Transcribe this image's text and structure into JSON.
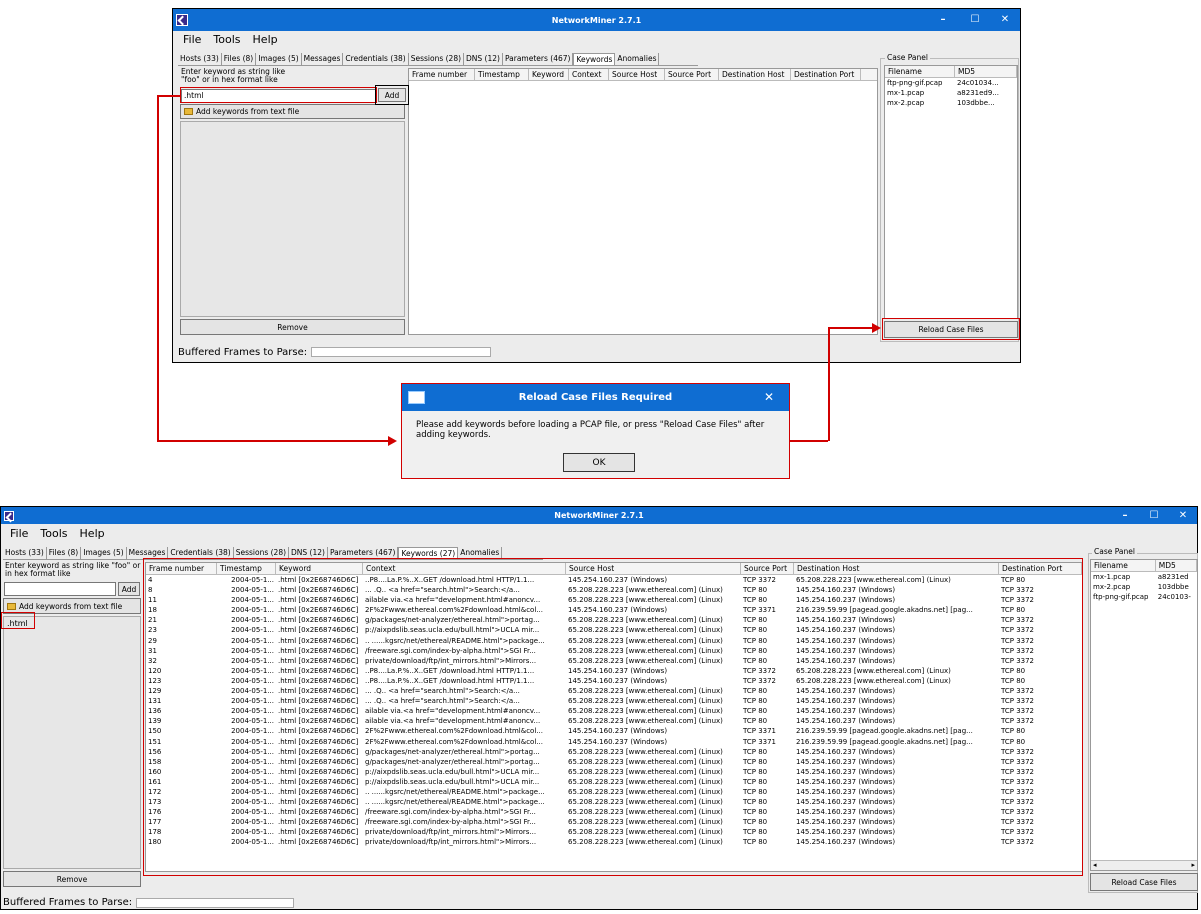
{
  "app": {
    "title": "NetworkMiner 2.7.1"
  },
  "menu": [
    "File",
    "Tools",
    "Help"
  ],
  "window_controls": [
    "–",
    "☐",
    "✕"
  ],
  "tabs_top": [
    {
      "label": "Hosts (33)"
    },
    {
      "label": "Files (8)"
    },
    {
      "label": "Images (5)"
    },
    {
      "label": "Messages"
    },
    {
      "label": "Credentials (38)"
    },
    {
      "label": "Sessions (28)"
    },
    {
      "label": "DNS (12)"
    },
    {
      "label": "Parameters (467)"
    },
    {
      "label": "Keywords"
    },
    {
      "label": "Anomalies"
    }
  ],
  "tabs_bottom": [
    {
      "label": "Hosts (33)"
    },
    {
      "label": "Files (8)"
    },
    {
      "label": "Images (5)"
    },
    {
      "label": "Messages"
    },
    {
      "label": "Credentials (38)"
    },
    {
      "label": "Sessions (28)"
    },
    {
      "label": "DNS (12)"
    },
    {
      "label": "Parameters (467)"
    },
    {
      "label": "Keywords (27)"
    },
    {
      "label": "Anomalies"
    }
  ],
  "keyword_panel": {
    "hint": "Enter keyword as string like \"foo\" or in hex format like",
    "input_value": ".html",
    "add_label": "Add",
    "add_from_file_label": "Add keywords from text file",
    "remove_label": "Remove",
    "list_items": [
      ".html"
    ]
  },
  "columns": [
    "Frame number",
    "Timestamp",
    "Keyword",
    "Context",
    "Source Host",
    "Source Port",
    "Destination Host",
    "Destination Port"
  ],
  "case_panel": {
    "legend": "Case Panel",
    "col_filename": "Filename",
    "col_md5": "MD5",
    "files_top": [
      {
        "name": "ftp-png-gif.pcap",
        "md5": "24c01034..."
      },
      {
        "name": "mx-1.pcap",
        "md5": "a8231ed9..."
      },
      {
        "name": "mx-2.pcap",
        "md5": "103dbbe..."
      }
    ],
    "files_bottom": [
      {
        "name": "mx-1.pcap",
        "md5": "a8231ed"
      },
      {
        "name": "mx-2.pcap",
        "md5": "103dbbe"
      },
      {
        "name": "ftp-png-gif.pcap",
        "md5": "24c0103-"
      }
    ],
    "reload_label": "Reload Case Files"
  },
  "status": {
    "buffered_label": "Buffered Frames to Parse:"
  },
  "dialog": {
    "title": "Reload Case Files Required",
    "message": "Please add keywords before loading a PCAP file, or press \"Reload Case Files\" after adding keywords.",
    "ok_label": "OK"
  },
  "rows": [
    [
      "4",
      "2004-05-1...",
      ".html [0x2E68746D6C]",
      "..P8....La.P.%..X..GET /download.html HTTP/1.1...",
      "145.254.160.237 (Windows)",
      "TCP 3372",
      "65.208.228.223 [www.ethereal.com] (Linux)",
      "TCP 80"
    ],
    [
      "8",
      "2004-05-1...",
      ".html [0x2E68746D6C]",
      "... .Q..          <a href=\"search.html\">Search:</a...",
      "65.208.228.223 [www.ethereal.com] (Linux)",
      "TCP 80",
      "145.254.160.237 (Windows)",
      "TCP 3372"
    ],
    [
      "11",
      "2004-05-1...",
      ".html [0x2E68746D6C]",
      "ailable via.<a href=\"development.html#anoncv...",
      "65.208.228.223 [www.ethereal.com] (Linux)",
      "TCP 80",
      "145.254.160.237 (Windows)",
      "TCP 3372"
    ],
    [
      "18",
      "2004-05-1...",
      ".html [0x2E68746D6C]",
      "2F%2Fwww.ethereal.com%2Fdownload.html&col...",
      "145.254.160.237 (Windows)",
      "TCP 3371",
      "216.239.59.99 [pagead.google.akadns.net] [pag...",
      "TCP 80"
    ],
    [
      "21",
      "2004-05-1...",
      ".html [0x2E68746D6C]",
      "g/packages/net-analyzer/ethereal.html\">portag...",
      "65.208.228.223 [www.ethereal.com] (Linux)",
      "TCP 80",
      "145.254.160.237 (Windows)",
      "TCP 3372"
    ],
    [
      "23",
      "2004-05-1...",
      ".html [0x2E68746D6C]",
      "p://aixpdslib.seas.ucla.edu/bull.html\">UCLA mir...",
      "65.208.228.223 [www.ethereal.com] (Linux)",
      "TCP 80",
      "145.254.160.237 (Windows)",
      "TCP 3372"
    ],
    [
      "29",
      "2004-05-1...",
      ".html [0x2E68746D6C]",
      ".. ......kgsrc/net/ethereal/README.html\">package...",
      "65.208.228.223 [www.ethereal.com] (Linux)",
      "TCP 80",
      "145.254.160.237 (Windows)",
      "TCP 3372"
    ],
    [
      "31",
      "2004-05-1...",
      ".html [0x2E68746D6C]",
      "/freeware.sgi.com/index-by-alpha.html\">SGI Fr...",
      "65.208.228.223 [www.ethereal.com] (Linux)",
      "TCP 80",
      "145.254.160.237 (Windows)",
      "TCP 3372"
    ],
    [
      "32",
      "2004-05-1...",
      ".html [0x2E68746D6C]",
      "private/download/ftp/int_mirrors.html\">Mirrors...",
      "65.208.228.223 [www.ethereal.com] (Linux)",
      "TCP 80",
      "145.254.160.237 (Windows)",
      "TCP 3372"
    ],
    [
      "120",
      "2004-05-1...",
      ".html [0x2E68746D6C]",
      "..P8....La.P.%..X..GET /download.html HTTP/1.1...",
      "145.254.160.237 (Windows)",
      "TCP 3372",
      "65.208.228.223 [www.ethereal.com] (Linux)",
      "TCP 80"
    ],
    [
      "123",
      "2004-05-1...",
      ".html [0x2E68746D6C]",
      "..P8....La.P.%..X..GET /download.html HTTP/1.1...",
      "145.254.160.237 (Windows)",
      "TCP 3372",
      "65.208.228.223 [www.ethereal.com] (Linux)",
      "TCP 80"
    ],
    [
      "129",
      "2004-05-1...",
      ".html [0x2E68746D6C]",
      "... .Q..          <a href=\"search.html\">Search:</a...",
      "65.208.228.223 [www.ethereal.com] (Linux)",
      "TCP 80",
      "145.254.160.237 (Windows)",
      "TCP 3372"
    ],
    [
      "131",
      "2004-05-1...",
      ".html [0x2E68746D6C]",
      "... .Q..          <a href=\"search.html\">Search:</a...",
      "65.208.228.223 [www.ethereal.com] (Linux)",
      "TCP 80",
      "145.254.160.237 (Windows)",
      "TCP 3372"
    ],
    [
      "136",
      "2004-05-1...",
      ".html [0x2E68746D6C]",
      "ailable via.<a href=\"development.html#anoncv...",
      "65.208.228.223 [www.ethereal.com] (Linux)",
      "TCP 80",
      "145.254.160.237 (Windows)",
      "TCP 3372"
    ],
    [
      "139",
      "2004-05-1...",
      ".html [0x2E68746D6C]",
      "ailable via.<a href=\"development.html#anoncv...",
      "65.208.228.223 [www.ethereal.com] (Linux)",
      "TCP 80",
      "145.254.160.237 (Windows)",
      "TCP 3372"
    ],
    [
      "150",
      "2004-05-1...",
      ".html [0x2E68746D6C]",
      "2F%2Fwww.ethereal.com%2Fdownload.html&col...",
      "145.254.160.237 (Windows)",
      "TCP 3371",
      "216.239.59.99 [pagead.google.akadns.net] [pag...",
      "TCP 80"
    ],
    [
      "151",
      "2004-05-1...",
      ".html [0x2E68746D6C]",
      "2F%2Fwww.ethereal.com%2Fdownload.html&col...",
      "145.254.160.237 (Windows)",
      "TCP 3371",
      "216.239.59.99 [pagead.google.akadns.net] [pag...",
      "TCP 80"
    ],
    [
      "156",
      "2004-05-1...",
      ".html [0x2E68746D6C]",
      "g/packages/net-analyzer/ethereal.html\">portag...",
      "65.208.228.223 [www.ethereal.com] (Linux)",
      "TCP 80",
      "145.254.160.237 (Windows)",
      "TCP 3372"
    ],
    [
      "158",
      "2004-05-1...",
      ".html [0x2E68746D6C]",
      "g/packages/net-analyzer/ethereal.html\">portag...",
      "65.208.228.223 [www.ethereal.com] (Linux)",
      "TCP 80",
      "145.254.160.237 (Windows)",
      "TCP 3372"
    ],
    [
      "160",
      "2004-05-1...",
      ".html [0x2E68746D6C]",
      "p://aixpdslib.seas.ucla.edu/bull.html\">UCLA mir...",
      "65.208.228.223 [www.ethereal.com] (Linux)",
      "TCP 80",
      "145.254.160.237 (Windows)",
      "TCP 3372"
    ],
    [
      "161",
      "2004-05-1...",
      ".html [0x2E68746D6C]",
      "p://aixpdslib.seas.ucla.edu/bull.html\">UCLA mir...",
      "65.208.228.223 [www.ethereal.com] (Linux)",
      "TCP 80",
      "145.254.160.237 (Windows)",
      "TCP 3372"
    ],
    [
      "172",
      "2004-05-1...",
      ".html [0x2E68746D6C]",
      ".. ......kgsrc/net/ethereal/README.html\">package...",
      "65.208.228.223 [www.ethereal.com] (Linux)",
      "TCP 80",
      "145.254.160.237 (Windows)",
      "TCP 3372"
    ],
    [
      "173",
      "2004-05-1...",
      ".html [0x2E68746D6C]",
      ".. ......kgsrc/net/ethereal/README.html\">package...",
      "65.208.228.223 [www.ethereal.com] (Linux)",
      "TCP 80",
      "145.254.160.237 (Windows)",
      "TCP 3372"
    ],
    [
      "176",
      "2004-05-1...",
      ".html [0x2E68746D6C]",
      "/freeware.sgi.com/index-by-alpha.html\">SGI Fr...",
      "65.208.228.223 [www.ethereal.com] (Linux)",
      "TCP 80",
      "145.254.160.237 (Windows)",
      "TCP 3372"
    ],
    [
      "177",
      "2004-05-1...",
      ".html [0x2E68746D6C]",
      "/freeware.sgi.com/index-by-alpha.html\">SGI Fr...",
      "65.208.228.223 [www.ethereal.com] (Linux)",
      "TCP 80",
      "145.254.160.237 (Windows)",
      "TCP 3372"
    ],
    [
      "178",
      "2004-05-1...",
      ".html [0x2E68746D6C]",
      "private/download/ftp/int_mirrors.html\">Mirrors...",
      "65.208.228.223 [www.ethereal.com] (Linux)",
      "TCP 80",
      "145.254.160.237 (Windows)",
      "TCP 3372"
    ],
    [
      "180",
      "2004-05-1...",
      ".html [0x2E68746D6C]",
      "private/download/ftp/int_mirrors.html\">Mirrors...",
      "65.208.228.223 [www.ethereal.com] (Linux)",
      "TCP 80",
      "145.254.160.237 (Windows)",
      "TCP 3372"
    ]
  ]
}
